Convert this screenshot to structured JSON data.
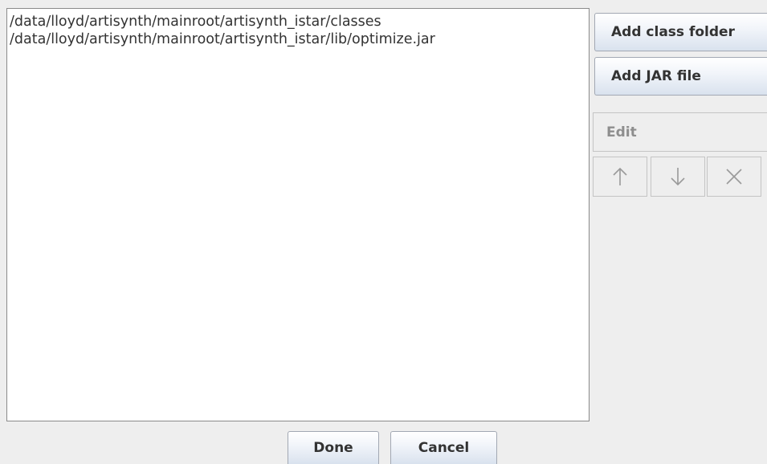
{
  "class_path_list": {
    "items": [
      "/data/lloyd/artisynth/mainroot/artisynth_istar/classes",
      "/data/lloyd/artisynth/mainroot/artisynth_istar/lib/optimize.jar"
    ]
  },
  "side_buttons": {
    "add_class_folder": "Add class folder",
    "add_jar_file": "Add JAR file",
    "edit": "Edit",
    "move_up_icon": "arrow-up-icon",
    "move_down_icon": "arrow-down-icon",
    "remove_icon": "close-icon"
  },
  "footer": {
    "done": "Done",
    "cancel": "Cancel"
  },
  "colors": {
    "disabled_text": "#8e8e8e",
    "button_border": "#a2a8b3",
    "list_background": "#ffffff",
    "window_background": "#eeeeee"
  }
}
